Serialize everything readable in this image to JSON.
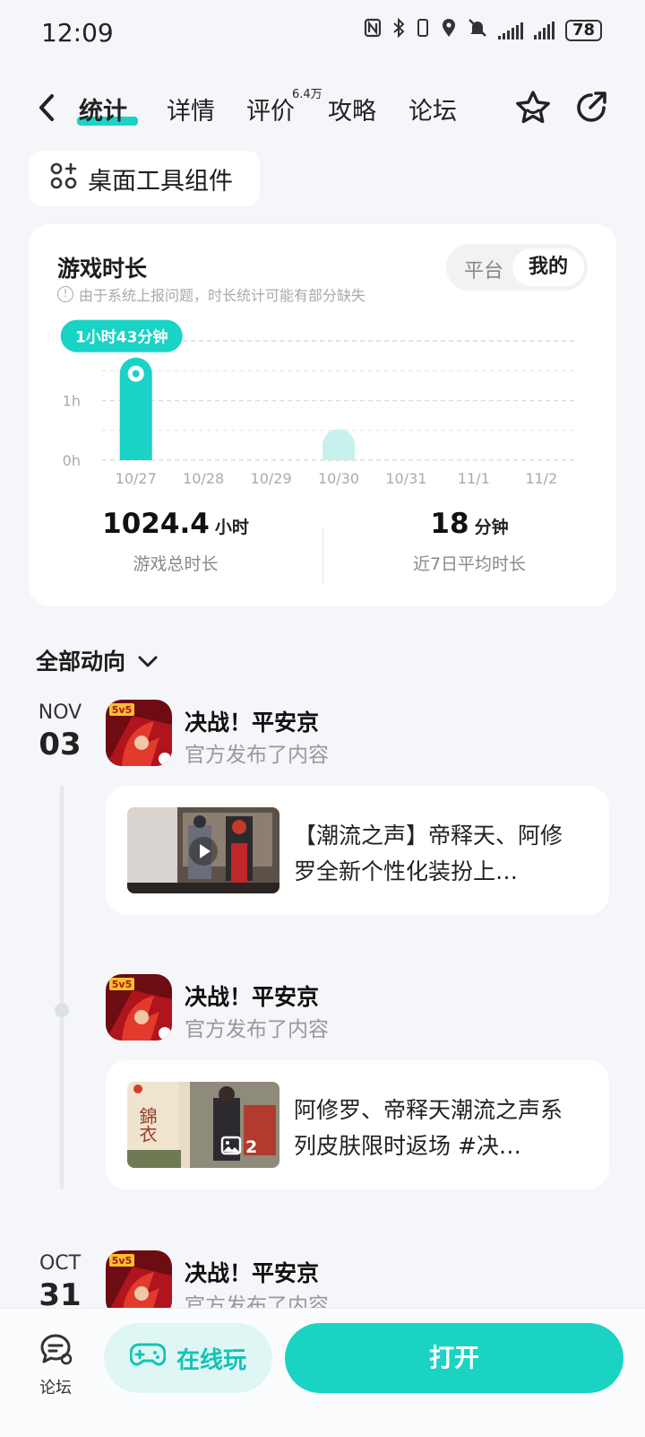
{
  "status_bar": {
    "time": "12:09",
    "battery": "78",
    "icons": [
      "nfc-icon",
      "bluetooth-icon",
      "vibrate-icon",
      "location-icon",
      "mute-icon",
      "signal-icon",
      "signal-icon",
      "battery-icon"
    ]
  },
  "nav": {
    "tabs": [
      {
        "label": "统计",
        "active": true
      },
      {
        "label": "详情"
      },
      {
        "label": "评价",
        "badge": "6.4万"
      },
      {
        "label": "攻略"
      },
      {
        "label": "论坛"
      }
    ]
  },
  "widget_button": {
    "label": "桌面工具组件"
  },
  "stats": {
    "title": "游戏时长",
    "note": "由于系统上报问题，时长统计可能有部分缺失",
    "segment": {
      "platform": "平台",
      "mine": "我的"
    },
    "tooltip": "1小时43分钟",
    "total": {
      "value": "1024.4",
      "unit": "小时",
      "label": "游戏总时长"
    },
    "average": {
      "value": "18",
      "unit": "分钟",
      "label": "近7日平均时长"
    }
  },
  "chart_data": {
    "type": "bar",
    "categories": [
      "10/27",
      "10/28",
      "10/29",
      "10/30",
      "10/31",
      "11/1",
      "11/2"
    ],
    "values": [
      1.72,
      0,
      0,
      0.52,
      0,
      0,
      0
    ],
    "y_ticks": [
      "0h",
      "1h",
      "2"
    ],
    "ylim": [
      0,
      2
    ],
    "highlight_index": 0,
    "bar_color": "#19d3c5",
    "grid": true
  },
  "feed": {
    "filter_label": "全部动向",
    "groups": [
      {
        "month": "NOV",
        "day": "03",
        "posts": [
          {
            "game": "决战！平安京",
            "action": "官方发布了内容",
            "content": "【潮流之声】帝释天、阿修罗全新个性化装扮上…",
            "type": "video"
          },
          {
            "game": "决战！平安京",
            "action": "官方发布了内容",
            "content": "阿修罗、帝释天潮流之声系列皮肤限时返场 #决…",
            "type": "image",
            "image_count": "2"
          }
        ]
      },
      {
        "month": "OCT",
        "day": "31",
        "posts": [
          {
            "game": "决战！平安京",
            "action": "官方发布了内容"
          }
        ]
      }
    ]
  },
  "bottom_bar": {
    "forum_label": "论坛",
    "online_label": "在线玩",
    "open_label": "打开"
  },
  "colors": {
    "accent": "#19d3c5",
    "background": "#f4f6f9"
  }
}
